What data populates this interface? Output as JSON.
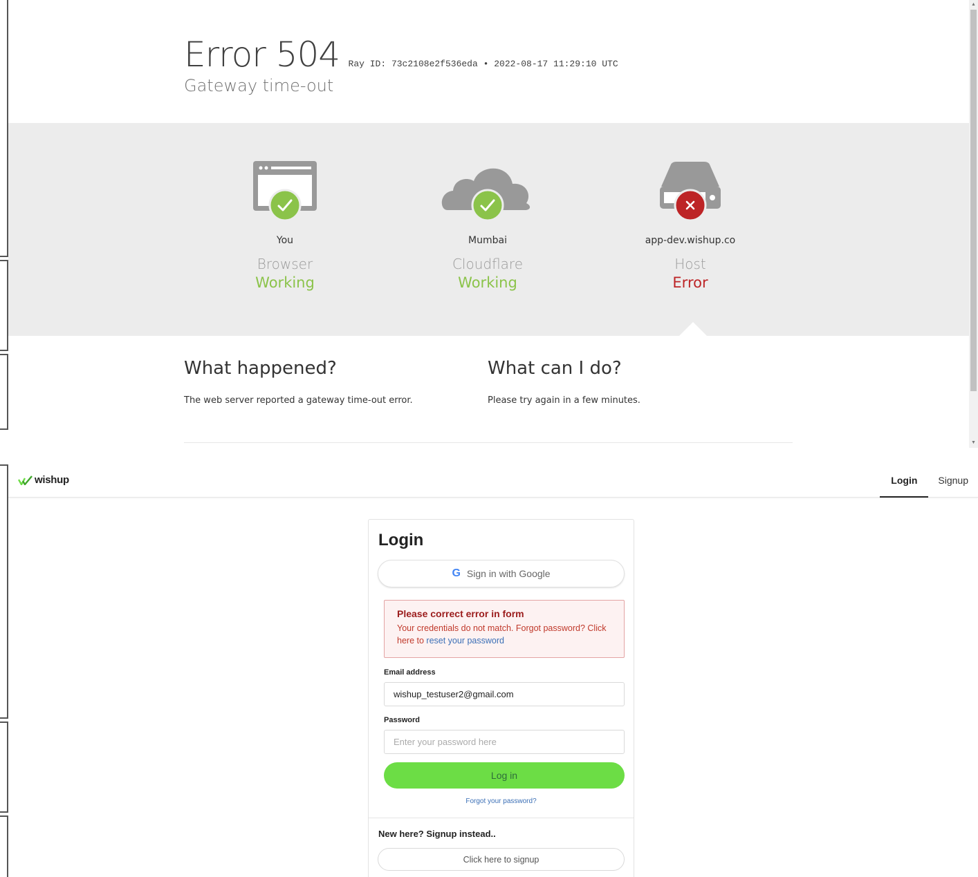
{
  "cloudflare": {
    "title": "Error 504",
    "ray": "Ray ID: 73c2108e2f536eda",
    "separator": "•",
    "timestamp": "2022-08-17 11:29:10 UTC",
    "subtitle": "Gateway time-out",
    "nodes": [
      {
        "location": "You",
        "role": "Browser",
        "status": "Working",
        "icon": "browser-icon",
        "status_icon": "check-icon"
      },
      {
        "location": "Mumbai",
        "role": "Cloudflare",
        "status": "Working",
        "icon": "cloud-icon",
        "status_icon": "check-icon"
      },
      {
        "location": "app-dev.wishup.co",
        "role": "Host",
        "status": "Error",
        "icon": "server-icon",
        "status_icon": "x-icon"
      }
    ],
    "what_happened": {
      "heading": "What happened?",
      "body": "The web server reported a gateway time-out error."
    },
    "what_can_i_do": {
      "heading": "What can I do?",
      "body": "Please try again in a few minutes."
    },
    "colors": {
      "ok": "#8bc34a",
      "error": "#bd2426",
      "band": "#ececec"
    }
  },
  "app": {
    "logo": "wishup",
    "nav": {
      "login": "Login",
      "signup": "Signup"
    },
    "login": {
      "title": "Login",
      "google_label": "Sign in with Google",
      "alert": {
        "title": "Please correct error in form",
        "message": "Your credentials do not match. Forgot password? Click here to",
        "link": "reset your password"
      },
      "email_label": "Email address",
      "email_value": "wishup_testuser2@gmail.com",
      "password_label": "Password",
      "password_placeholder": "Enter your password here",
      "submit": "Log in",
      "forgot": "Forgot your password?",
      "signup_heading": "New here? Signup instead..",
      "signup_button": "Click here to signup"
    },
    "colors": {
      "accent": "#6cdd45",
      "link": "#3b6fb6",
      "alert_text": "#c0392b"
    }
  }
}
